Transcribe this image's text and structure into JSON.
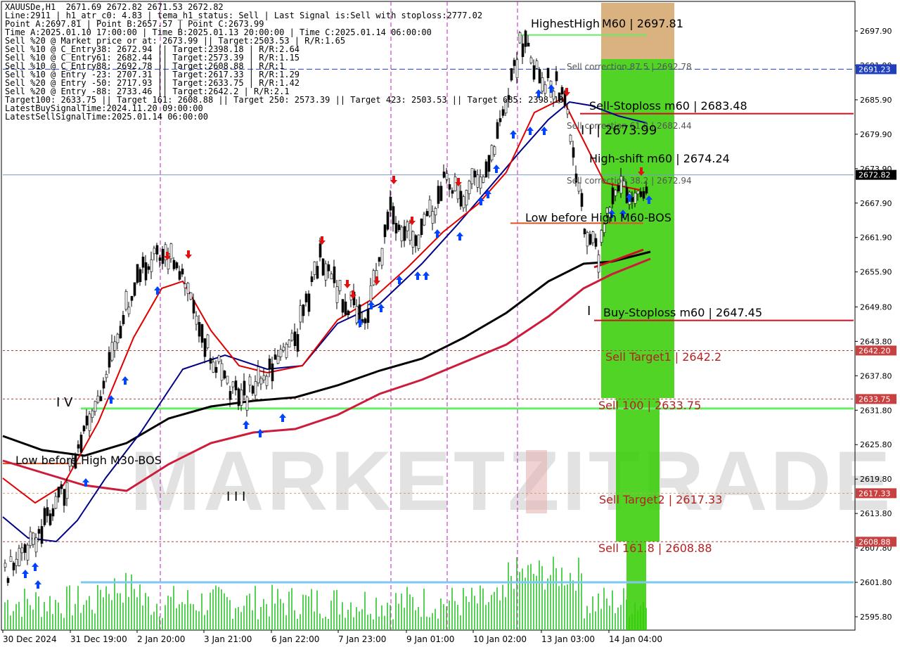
{
  "info_lines": [
    "XAUUSDe,H1  2671.69 2672.82 2671.53 2672.82",
    "Line:2911 | h1_atr_c0: 4.83 | tema_h1_status: Sell | Last Signal is:Sell with stoploss:2777.02",
    "Point A:2697.81 | Point B:2657.57 | Point C:2673.99",
    "Time A:2025.01.10 17:00:00 | Time B:2025.01.13 20:00:00 | Time C:2025.01.14 06:00:00",
    "Sell %20 @ Market price or at: 2673.99 || Target:2503.53 | R/R:1.65",
    "Sell %10 @ C_Entry38: 2672.94 || Target:2398.18 | R/R:2.64",
    "Sell %10 @ C_Entry61: 2682.44 || Target:2573.39 | R/R:1.15",
    "Sell %10 @ C_Entry88: 2692.78 || Target:2608.88 | R/R:1",
    "Sell %10 @ Entry -23: 2707.31 || Target:2617.33 | R/R:1.29",
    "Sell %20 @ Entry -50: 2717.93 || Target:2633.75 | R/R:1.42",
    "Sell %20 @ Entry -88: 2733.46 || Target:2642.2 | R/R:2.1",
    "Target100: 2633.75 || Target 161: 2608.88 || Target 250: 2573.39 || Target 423: 2503.53 || Target 685: 2398.18",
    "LatestBuySignalTime:2024.11.20 09:00:00",
    "LatestSellSignalTime:2025.01.14 06:00:00"
  ],
  "chart_data": {
    "type": "candlestick",
    "symbol": "XAUUSDe,H1",
    "ylim": [
      2593.0,
      2703.0
    ],
    "x_tick_labels": [
      "30 Dec 2024",
      "31 Dec 19:00",
      "2 Jan 20:00",
      "3 Jan 21:00",
      "6 Jan 22:00",
      "7 Jan 23:00",
      "9 Jan 01:00",
      "10 Jan 02:00",
      "13 Jan 03:00",
      "14 Jan 04:00"
    ],
    "y_ticks": [
      2697.9,
      2691.9,
      2685.9,
      2679.9,
      2673.9,
      2667.9,
      2661.9,
      2655.9,
      2649.8,
      2643.8,
      2637.8,
      2631.8,
      2625.8,
      2619.8,
      2613.8,
      2607.8,
      2601.8,
      2595.8
    ],
    "price_tags": [
      {
        "label": "2691.23",
        "value": 2691.23,
        "bg": "#1f3fbf"
      },
      {
        "label": "2672.82",
        "value": 2672.82,
        "bg": "#000000"
      },
      {
        "label": "2642.20",
        "value": 2642.2,
        "bg": "#c84040"
      },
      {
        "label": "2633.75",
        "value": 2633.75,
        "bg": "#c84040"
      },
      {
        "label": "2617.33",
        "value": 2617.33,
        "bg": "#c84040"
      },
      {
        "label": "2608.88",
        "value": 2608.88,
        "bg": "#c84040"
      }
    ],
    "level_labels": [
      {
        "text": "HighestHigh",
        "color": "#000000"
      },
      {
        "text": "M60 | 2697.81",
        "color": "#000000"
      },
      {
        "text": "Sell correction 87.5 | 2692.78",
        "color": "#555555"
      },
      {
        "text": "Sell-Stoploss m60 | 2683.48",
        "color": "#000000"
      },
      {
        "text": "Sell correction 61.8 | 2682.44",
        "color": "#555555"
      },
      {
        "text": "I I | 2673.99",
        "color": "#000000"
      },
      {
        "text": "High-shift m60 | 2674.24",
        "color": "#000000"
      },
      {
        "text": "Sell correction 38.2 | 2672.94",
        "color": "#555555"
      },
      {
        "text": "Low before High  M60-BOS",
        "color": "#000000"
      },
      {
        "text": "Buy-Stoploss m60 | 2647.45",
        "color": "#000000"
      },
      {
        "text": "Sell Target1 | 2642.2",
        "color": "#b22222"
      },
      {
        "text": "Sell 100 | 2633.75",
        "color": "#b22222"
      },
      {
        "text": "Low before High     M30-BOS",
        "color": "#000000"
      },
      {
        "text": "Sell Target2 | 2617.33",
        "color": "#b22222"
      },
      {
        "text": "Sell 161.8 | 2608.88",
        "color": "#b22222"
      }
    ],
    "wave_labels": [
      "I V",
      "I I I",
      "I"
    ],
    "watermark": "MARKETZITRADE",
    "colors": {
      "sell_zone": "#33cc00",
      "stoploss_zone": "#d2a468",
      "ma_black": "#000000",
      "ma_red": "#cc1b3b",
      "ma_blue": "#000088",
      "ma_bright_red": "#e00000",
      "buy_arrow": "#0044ff",
      "sell_arrow": "#e01010"
    }
  }
}
